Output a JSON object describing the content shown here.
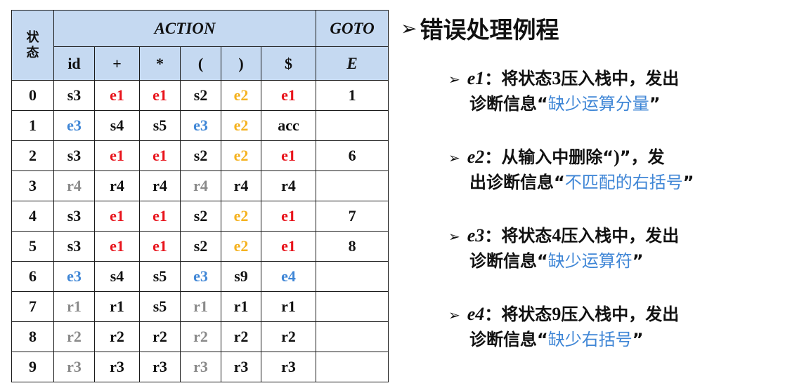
{
  "table": {
    "state_header": "状\n态",
    "action_header": "ACTION",
    "goto_header": "GOTO",
    "columns": [
      "id",
      "+",
      "*",
      "(",
      ")",
      "$"
    ],
    "goto_columns": [
      "E"
    ],
    "rows": [
      {
        "state": "0",
        "cells": [
          "s3",
          "e1",
          "e1",
          "s2",
          "e2",
          "e1"
        ],
        "colors": [
          "black",
          "red",
          "red",
          "black",
          "orange",
          "red"
        ],
        "goto": "1"
      },
      {
        "state": "1",
        "cells": [
          "e3",
          "s4",
          "s5",
          "e3",
          "e2",
          "acc"
        ],
        "colors": [
          "blue",
          "black",
          "black",
          "blue",
          "orange",
          "black"
        ],
        "goto": ""
      },
      {
        "state": "2",
        "cells": [
          "s3",
          "e1",
          "e1",
          "s2",
          "e2",
          "e1"
        ],
        "colors": [
          "black",
          "red",
          "red",
          "black",
          "orange",
          "red"
        ],
        "goto": "6"
      },
      {
        "state": "3",
        "cells": [
          "r4",
          "r4",
          "r4",
          "r4",
          "r4",
          "r4"
        ],
        "colors": [
          "gray",
          "black",
          "black",
          "gray",
          "black",
          "black"
        ],
        "goto": ""
      },
      {
        "state": "4",
        "cells": [
          "s3",
          "e1",
          "e1",
          "s2",
          "e2",
          "e1"
        ],
        "colors": [
          "black",
          "red",
          "red",
          "black",
          "orange",
          "red"
        ],
        "goto": "7"
      },
      {
        "state": "5",
        "cells": [
          "s3",
          "e1",
          "e1",
          "s2",
          "e2",
          "e1"
        ],
        "colors": [
          "black",
          "red",
          "red",
          "black",
          "orange",
          "red"
        ],
        "goto": "8"
      },
      {
        "state": "6",
        "cells": [
          "e3",
          "s4",
          "s5",
          "e3",
          "s9",
          "e4"
        ],
        "colors": [
          "blue",
          "black",
          "black",
          "blue",
          "black",
          "blue"
        ],
        "goto": ""
      },
      {
        "state": "7",
        "cells": [
          "r1",
          "r1",
          "s5",
          "r1",
          "r1",
          "r1"
        ],
        "colors": [
          "gray",
          "black",
          "black",
          "gray",
          "black",
          "black"
        ],
        "goto": ""
      },
      {
        "state": "8",
        "cells": [
          "r2",
          "r2",
          "r2",
          "r2",
          "r2",
          "r2"
        ],
        "colors": [
          "gray",
          "black",
          "black",
          "gray",
          "black",
          "black"
        ],
        "goto": ""
      },
      {
        "state": "9",
        "cells": [
          "r3",
          "r3",
          "r3",
          "r3",
          "r3",
          "r3"
        ],
        "colors": [
          "gray",
          "black",
          "black",
          "gray",
          "black",
          "black"
        ],
        "goto": ""
      }
    ]
  },
  "notes": {
    "title": "错误处理例程",
    "items": [
      {
        "code": "e1",
        "sep": "：",
        "desc_a": "将状态",
        "desc_num": "3",
        "desc_b": "压入栈中，发出",
        "line2_a": "诊断信息“",
        "message": "缺少运算分量",
        "line2_b": "”"
      },
      {
        "code": "e2",
        "sep": "：",
        "desc_a": "从输入中删除“",
        "desc_num": ")",
        "desc_b": "”，发",
        "line2_a": "出诊断信息“",
        "message": "不匹配的右括号",
        "line2_b": "”"
      },
      {
        "code": "e3",
        "sep": "：",
        "desc_a": "将状态",
        "desc_num": "4",
        "desc_b": "压入栈中，发出",
        "line2_a": "诊断信息“",
        "message": "缺少运算符",
        "line2_b": "”"
      },
      {
        "code": "e4",
        "sep": "：",
        "desc_a": "将状态",
        "desc_num": "9",
        "desc_b": "压入栈中，发出",
        "line2_a": "诊断信息“",
        "message": "缺少右括号",
        "line2_b": "”"
      }
    ]
  },
  "colors": {
    "header_bg": "#c5d9f1",
    "red": "#e8141c",
    "orange": "#f5b21f",
    "blue": "#3f86d6",
    "gray": "#8a8a8a",
    "black": "#111111"
  }
}
